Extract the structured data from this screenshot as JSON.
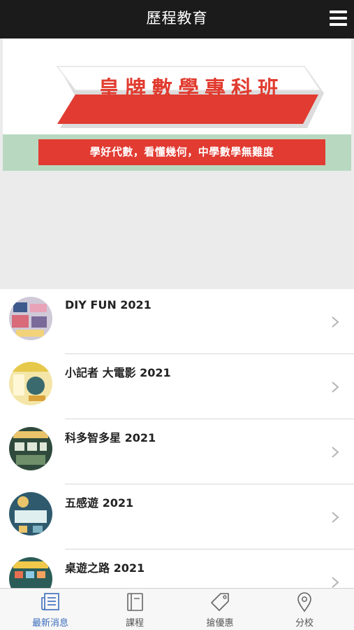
{
  "header": {
    "title": "歷程教育"
  },
  "banner": {
    "title": "皇牌數學專科班",
    "subtitle": "學好代數，看懂幾何，中學數學無難度"
  },
  "list": {
    "items": [
      {
        "title": "DIY FUN 2021"
      },
      {
        "title": "小記者 大電影 2021"
      },
      {
        "title": "科多智多星 2021"
      },
      {
        "title": "五感遊 2021"
      },
      {
        "title": "桌遊之路 2021"
      }
    ]
  },
  "tabbar": {
    "tabs": [
      {
        "label": "最新消息",
        "icon": "news-icon",
        "active": true
      },
      {
        "label": "課程",
        "icon": "book-icon"
      },
      {
        "label": "搶優惠",
        "icon": "tag-icon"
      },
      {
        "label": "分校",
        "icon": "location-pin-icon"
      }
    ]
  },
  "colors": {
    "accent": "#e13b32",
    "header_bg": "#1b1b1b",
    "tab_active": "#3a6dbb",
    "banner_band": "#b8d9c0"
  }
}
